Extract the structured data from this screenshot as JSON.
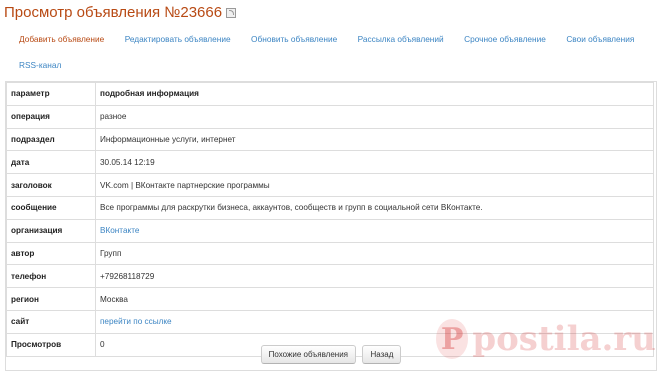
{
  "header": {
    "title": "Просмотр объявления №23666",
    "rss_icon": "rss-icon"
  },
  "nav": {
    "items": [
      "Добавить объявление",
      "Редактировать объявление",
      "Обновить объявление",
      "Рассылка объявлений",
      "Срочное объявление",
      "Свои объявления",
      "RSS-канал"
    ],
    "active_color": "#b84a14",
    "link_color": "#3c85c3"
  },
  "table": {
    "header": {
      "key": "параметр",
      "value": "подробная информация"
    },
    "rows": [
      {
        "key": "операция",
        "value": "разное"
      },
      {
        "key": "подраздел",
        "value": "Информационные услуги, интернет"
      },
      {
        "key": "дата",
        "value": "30.05.14 12:19"
      },
      {
        "key": "заголовок",
        "value": "VK.com | ВКонтакте партнерские программы"
      },
      {
        "key": "сообщение",
        "value": "Все программы для раскрутки бизнеса, аккаунтов, сообществ и групп в социальной сети ВКонтакте."
      },
      {
        "key": "организация",
        "value": "ВКонтакте"
      },
      {
        "key": "автор",
        "value": "Групп"
      },
      {
        "key": "телефон",
        "value": "+79268118729"
      },
      {
        "key": "регион",
        "value": "Москва"
      },
      {
        "key": "сайт",
        "value": "перейти по ссылке"
      },
      {
        "key": "Просмотров",
        "value": "0"
      }
    ]
  },
  "buttons": {
    "similar": "Похожие объявления",
    "back": "Назад"
  },
  "watermark": {
    "text": "postila.ru",
    "letter": "P"
  }
}
